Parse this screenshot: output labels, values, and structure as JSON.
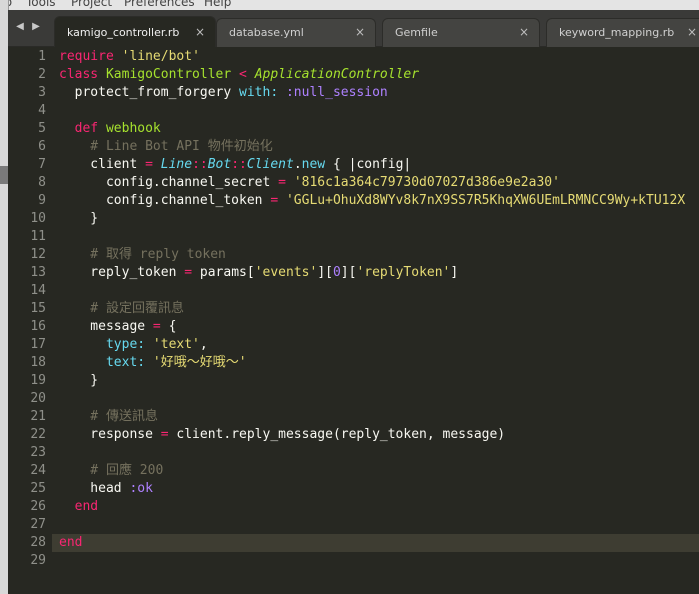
{
  "menubar": {
    "items": [
      "Tools",
      "Project",
      "Preferences",
      "Help"
    ],
    "partial_first": "to"
  },
  "tabs": [
    {
      "label": "kamigo_controller.rb",
      "active": true
    },
    {
      "label": "database.yml",
      "active": false
    },
    {
      "label": "Gemfile",
      "active": false
    },
    {
      "label": "keyword_mapping.rb",
      "active": false
    }
  ],
  "tab_nav": {
    "prev": "◀",
    "next": "▶"
  },
  "close_glyph": "×",
  "editor": {
    "current_line": 28,
    "lines": [
      {
        "num": "1",
        "tokens": [
          [
            "kw",
            "require "
          ],
          [
            "str",
            "'line/bot'"
          ]
        ]
      },
      {
        "num": "2",
        "tokens": [
          [
            "kw",
            "class "
          ],
          [
            "cls",
            "KamigoController"
          ],
          [
            "kw",
            " < "
          ],
          [
            "inh",
            "ApplicationController"
          ]
        ]
      },
      {
        "num": "3",
        "tokens": [
          [
            "plain",
            "  protect_from_forgery "
          ],
          [
            "sup",
            "with: "
          ],
          [
            "sym",
            ":null_session"
          ]
        ]
      },
      {
        "num": "4",
        "tokens": []
      },
      {
        "num": "5",
        "tokens": [
          [
            "kw",
            "  def "
          ],
          [
            "fn",
            "webhook"
          ]
        ]
      },
      {
        "num": "6",
        "tokens": [
          [
            "cm",
            "    # Line Bot API 物件初始化"
          ]
        ]
      },
      {
        "num": "7",
        "tokens": [
          [
            "plain",
            "    client "
          ],
          [
            "op",
            "= "
          ],
          [
            "const",
            "Line"
          ],
          [
            "op",
            "::"
          ],
          [
            "const",
            "Bot"
          ],
          [
            "op",
            "::"
          ],
          [
            "const",
            "Client"
          ],
          [
            "plain",
            "."
          ],
          [
            "sup",
            "new"
          ],
          [
            "plain",
            " { |config|"
          ]
        ]
      },
      {
        "num": "8",
        "tokens": [
          [
            "plain",
            "      config.channel_secret "
          ],
          [
            "op",
            "= "
          ],
          [
            "str",
            "'816c1a364c79730d07027d386e9e2a30'"
          ]
        ]
      },
      {
        "num": "9",
        "tokens": [
          [
            "plain",
            "      config.channel_token "
          ],
          [
            "op",
            "= "
          ],
          [
            "str",
            "'GGLu+OhuXd8WYv8k7nX9SS7R5KhqXW6UEmLRMNCC9Wy+kTU12X"
          ]
        ]
      },
      {
        "num": "10",
        "tokens": [
          [
            "plain",
            "    }"
          ]
        ]
      },
      {
        "num": "11",
        "tokens": []
      },
      {
        "num": "12",
        "tokens": [
          [
            "cm",
            "    # 取得 reply token"
          ]
        ]
      },
      {
        "num": "13",
        "tokens": [
          [
            "plain",
            "    reply_token "
          ],
          [
            "op",
            "= "
          ],
          [
            "plain",
            "params["
          ],
          [
            "str",
            "'events'"
          ],
          [
            "plain",
            "]["
          ],
          [
            "num",
            "0"
          ],
          [
            "plain",
            "]["
          ],
          [
            "str",
            "'replyToken'"
          ],
          [
            "plain",
            "]"
          ]
        ]
      },
      {
        "num": "14",
        "tokens": []
      },
      {
        "num": "15",
        "tokens": [
          [
            "cm",
            "    # 設定回覆訊息"
          ]
        ]
      },
      {
        "num": "16",
        "tokens": [
          [
            "plain",
            "    message "
          ],
          [
            "op",
            "= "
          ],
          [
            "plain",
            "{"
          ]
        ]
      },
      {
        "num": "17",
        "tokens": [
          [
            "sup",
            "      type: "
          ],
          [
            "str",
            "'text'"
          ],
          [
            "plain",
            ","
          ]
        ]
      },
      {
        "num": "18",
        "tokens": [
          [
            "sup",
            "      text: "
          ],
          [
            "str",
            "'好哦～好哦～'"
          ]
        ]
      },
      {
        "num": "19",
        "tokens": [
          [
            "plain",
            "    }"
          ]
        ]
      },
      {
        "num": "20",
        "tokens": []
      },
      {
        "num": "21",
        "tokens": [
          [
            "cm",
            "    # 傳送訊息"
          ]
        ]
      },
      {
        "num": "22",
        "tokens": [
          [
            "plain",
            "    response "
          ],
          [
            "op",
            "= "
          ],
          [
            "plain",
            "client.reply_message(reply_token, message)"
          ]
        ]
      },
      {
        "num": "23",
        "tokens": []
      },
      {
        "num": "24",
        "tokens": [
          [
            "cm",
            "    # 回應 200"
          ]
        ]
      },
      {
        "num": "25",
        "tokens": [
          [
            "plain",
            "    head "
          ],
          [
            "sym",
            ":ok"
          ]
        ]
      },
      {
        "num": "26",
        "tokens": [
          [
            "kw",
            "  end"
          ]
        ]
      },
      {
        "num": "27",
        "tokens": []
      },
      {
        "num": "28",
        "tokens": [
          [
            "kw",
            "end"
          ]
        ]
      },
      {
        "num": "29",
        "tokens": []
      }
    ]
  },
  "colors": {
    "background": "#272822",
    "keyword": "#f92672",
    "class": "#a6e22e",
    "string": "#e6db74",
    "symbol": "#ae81ff",
    "comment": "#75715e",
    "support": "#66d9ef",
    "line_highlight": "#3e3d32"
  }
}
